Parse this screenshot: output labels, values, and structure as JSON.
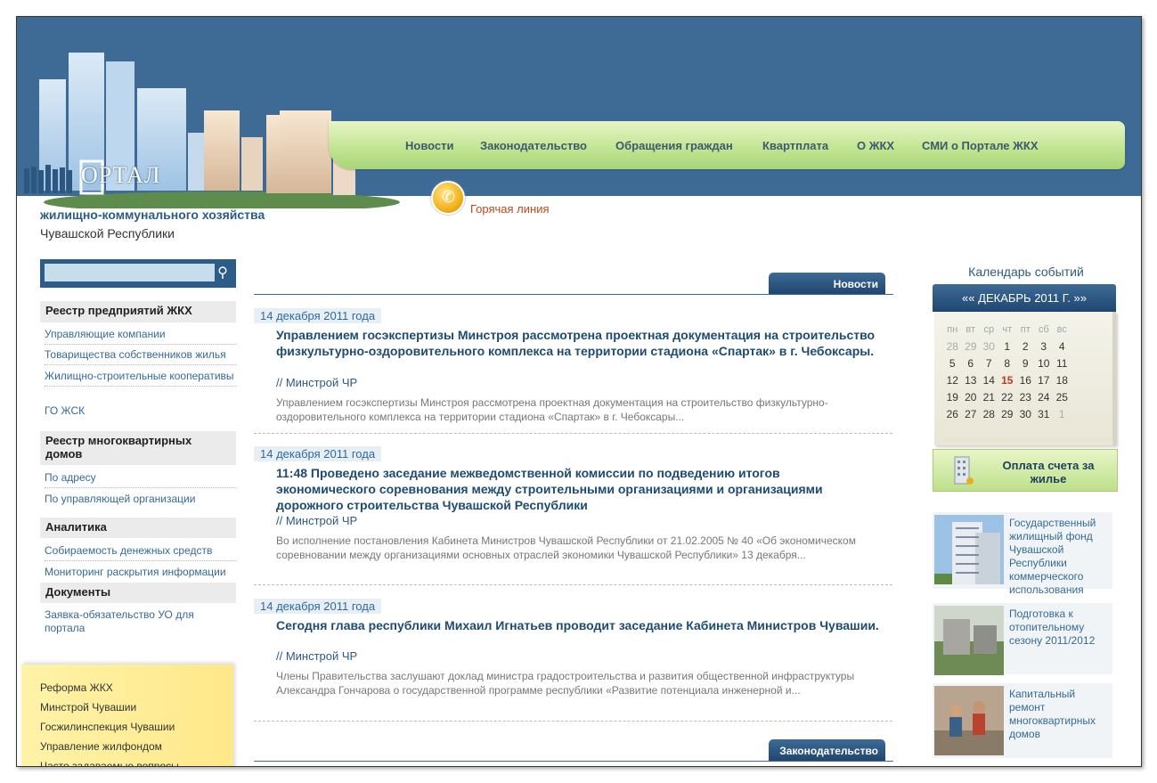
{
  "header": {
    "logo_text": "ОРТАЛ",
    "site_title": "жилищно-коммунального хозяйства",
    "site_subtitle": "Чувашской Республики",
    "hotline": "Горячая линия"
  },
  "nav": [
    {
      "label": "Новости"
    },
    {
      "label": "Законодательство"
    },
    {
      "label": "Обращения граждан"
    },
    {
      "label": "Квартплата"
    },
    {
      "label": "О ЖКХ"
    },
    {
      "label": "СМИ о Портале ЖКХ"
    }
  ],
  "search": {
    "placeholder": "",
    "value": ""
  },
  "sidebar": {
    "sections": [
      {
        "title": "Реестр предприятий ЖКХ",
        "links": [
          "Управляющие компании",
          "Товарищества собственников жилья",
          "Жилищно-строительные кооперативы",
          "ГО ЖСК"
        ]
      },
      {
        "title": "Реестр многоквартирных домов",
        "links": [
          "По адресу",
          "По управляющей организации"
        ]
      },
      {
        "title": "Аналитика",
        "links": [
          "Собираемость денежных средств",
          "Мониторинг раскрытия информации"
        ]
      },
      {
        "title": "Документы",
        "links": [
          "Заявка-обязательство УО для портала"
        ]
      }
    ],
    "yellow_links": [
      "Реформа ЖКХ",
      "Минстрой Чувашии",
      "Госжилинспекция Чувашии",
      "Управление жилфондом",
      "Часто задаваемые вопросы"
    ]
  },
  "main": {
    "news_tab": "Новости",
    "legislation_tab": "Законодательство",
    "news": [
      {
        "date": "14 декабря 2011 года",
        "title": "Управлением госэкспертизы Минстроя рассмотрена проектная документация на строительство физкультурно-оздоровительного комплекса на территории стадиона «Спартак» в г. Чебоксары.",
        "source": "// Минстрой ЧР",
        "body": "Управлением госэкспертизы Минстроя рассмотрена проектная документация на строительство физкультурно-оздоровительного комплекса на территории стадиона «Спартак» в г. Чебоксары..."
      },
      {
        "date": "14 декабря 2011 года",
        "title": "11:48 Проведено заседание межведомственной комиссии по подведению итогов экономического соревнования между строительными организациями и организациями дорожного строительства Чувашской Республики",
        "source": "// Минстрой ЧР",
        "body": "Во исполнение постановления Кабинета Министров Чувашской Республики от 21.02.2005 № 40 «Об экономическом соревновании между организациями основных отраслей экономики Чувашской Республики» 13 декабря..."
      },
      {
        "date": "14 декабря 2011 года",
        "title": "Сегодня глава республики Михаил Игнатьев проводит заседание Кабинета Министров Чувашии.",
        "source": "// Минстрой ЧР",
        "body": "Члены Правительства заслушают доклад министра градостроительства и развития общественной инфраструктуры Александра Гончарова о государственной программе республики «Развитие потенциала инженерной и..."
      }
    ]
  },
  "calendar": {
    "title": "Календарь событий",
    "prev": "««",
    "month": "ДЕКАБРЬ 2011 Г.",
    "next": "»»",
    "weekdays": [
      "пн",
      "вт",
      "ср",
      "чт",
      "пт",
      "сб",
      "вс"
    ],
    "weeks": [
      [
        "28",
        "29",
        "30",
        "1",
        "2",
        "3",
        "4"
      ],
      [
        "5",
        "6",
        "7",
        "8",
        "9",
        "10",
        "11"
      ],
      [
        "12",
        "13",
        "14",
        "15",
        "16",
        "17",
        "18"
      ],
      [
        "19",
        "20",
        "21",
        "22",
        "23",
        "24",
        "25"
      ],
      [
        "26",
        "27",
        "28",
        "29",
        "30",
        "31",
        "1"
      ]
    ],
    "today": "15"
  },
  "payment": {
    "label": "Оплата счета за жилье"
  },
  "cards": [
    {
      "text": "Государственный жилищный фонд Чувашской Республики коммерческого использования"
    },
    {
      "text": "Подготовка к отопительному сезону 2011/2012"
    },
    {
      "text": "Капитальный ремонт многоквартирных домов"
    }
  ],
  "colors": {
    "header_blue": "#3e6b96",
    "nav_green": "#c3e594",
    "link_blue": "#356a96",
    "hotline_orange": "#c4461a"
  }
}
